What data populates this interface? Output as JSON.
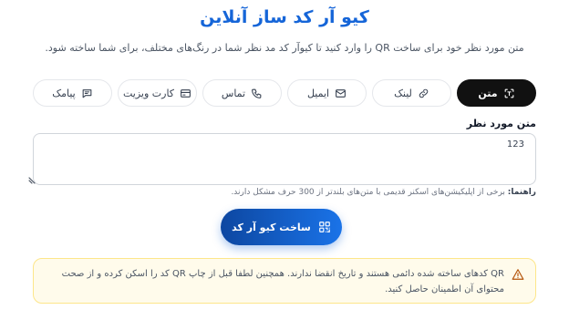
{
  "header": {
    "title": "کیو آر کد ساز آنلاین",
    "subtitle": "متن مورد نظر خود برای ساخت QR را وارد کنید تا کیوآر کد مد نظر شما در رنگ‌های مختلف، برای شما ساخته شود."
  },
  "tabs": [
    {
      "label": "متن",
      "icon": "text-scan-icon",
      "active": true
    },
    {
      "label": "لینک",
      "icon": "link-icon",
      "active": false
    },
    {
      "label": "ایمیل",
      "icon": "mail-icon",
      "active": false
    },
    {
      "label": "تماس",
      "icon": "phone-icon",
      "active": false
    },
    {
      "label": "کارت ویزیت",
      "icon": "id-card-icon",
      "active": false
    },
    {
      "label": "پیامک",
      "icon": "message-icon",
      "active": false
    }
  ],
  "form": {
    "label": "متن مورد نظر",
    "value": "123",
    "hint_prefix": "راهنما:",
    "hint_text": " برخی از اپلیکیشن‌های اسکنر قدیمی با متن‌های بلندتر از 300 حرف مشکل دارند."
  },
  "submit": {
    "label": "ساخت کیو آر کد",
    "icon": "qr-code-icon"
  },
  "notice": {
    "text": "QR کدهای ساخته شده دائمی هستند و تاریخ انقضا ندارند. همچنین لطفا قبل از چاپ QR کد را اسکن کرده و از صحت محتوای آن اطمینان حاصل کنید.",
    "icon": "warning-icon"
  },
  "colors": {
    "accent": "#1565d8",
    "tab_active": "#111111",
    "notice_bg": "#fffbeb"
  }
}
